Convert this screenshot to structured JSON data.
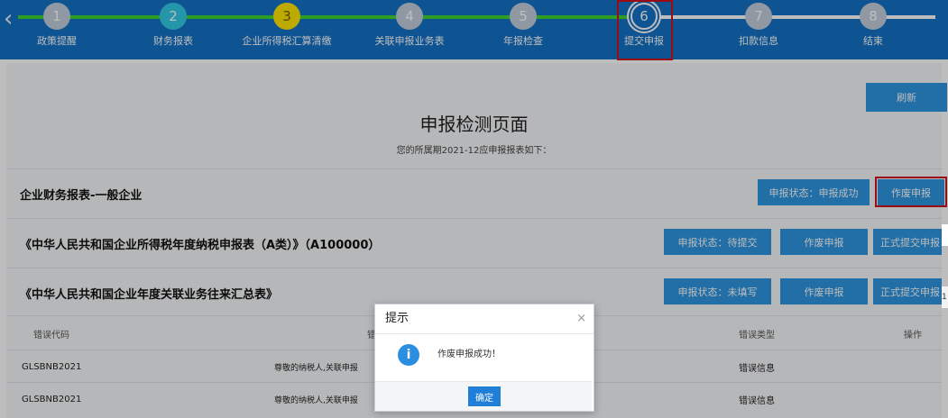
{
  "steps": [
    {
      "num": "1",
      "label": "政策提醒"
    },
    {
      "num": "2",
      "label": "财务报表"
    },
    {
      "num": "3",
      "label": "企业所得税汇算清缴"
    },
    {
      "num": "4",
      "label": "关联申报业务表"
    },
    {
      "num": "5",
      "label": "年报检查"
    },
    {
      "num": "6",
      "label": "提交申报"
    },
    {
      "num": "7",
      "label": "扣款信息"
    },
    {
      "num": "8",
      "label": "结束"
    }
  ],
  "icons": {
    "back": "chevron-left-icon",
    "close": "close-icon",
    "info": "info-icon"
  },
  "colors": {
    "header": "#1572c6",
    "done": "#3ed52f",
    "button": "#2f95e0",
    "highlight": "#d0111b"
  },
  "page": {
    "refresh": "刷新",
    "title": "申报检测页面",
    "subtitle": "您的所属期2021-12应申报报表如下："
  },
  "reports": [
    {
      "title": "企业财务报表-一般企业",
      "status": "申报状态：申报成功",
      "void": "作废申报"
    },
    {
      "title": "《中华人民共和国企业所得税年度纳税申报表（A类）》（A100000）",
      "status": "申报状态：待提交",
      "void": "作废申报",
      "submit": "正式提交申报"
    },
    {
      "title": "《中华人民共和国企业年度关联业务往来汇总表》",
      "status": "申报状态：未填写",
      "void": "作废申报",
      "submit": "正式提交申报"
    }
  ],
  "table": {
    "headers": {
      "code": "错误代码",
      "desc": "错",
      "type": "错误类型",
      "action": "操作"
    },
    "rows": [
      {
        "code": "GLSBNB2021",
        "desc": "尊敬的纳税人,关联申报",
        "type": "错误信息"
      },
      {
        "code": "GLSBNB2021",
        "desc": "尊敬的纳税人,关联申报",
        "type": "错误信息"
      }
    ]
  },
  "side_tabs": [
    "",
    "1"
  ],
  "modal": {
    "title": "提示",
    "close": "×",
    "info_glyph": "i",
    "message": "作废申报成功！",
    "ok": "确定"
  }
}
